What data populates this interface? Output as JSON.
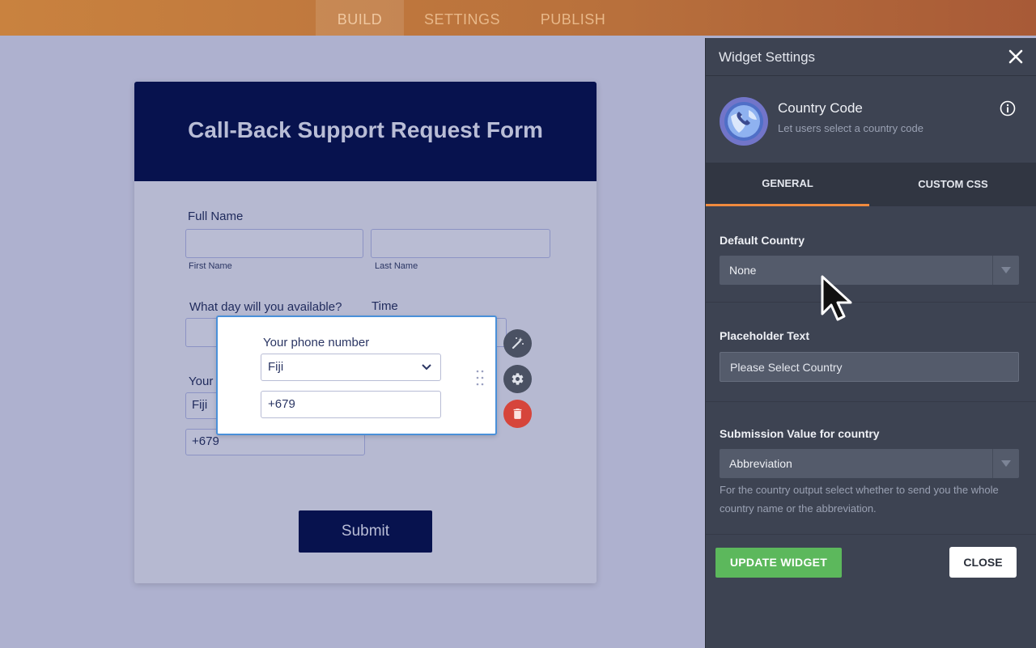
{
  "topbar": {
    "tabs": [
      {
        "label": "BUILD",
        "active": true
      },
      {
        "label": "SETTINGS",
        "active": false
      },
      {
        "label": "PUBLISH",
        "active": false
      }
    ]
  },
  "form": {
    "title": "Call-Back Support Request Form",
    "full_name_label": "Full Name",
    "first_name_sublabel": "First Name",
    "last_name_sublabel": "Last Name",
    "day_label": "What day will you available?",
    "time_label": "Time",
    "phone_label_partial": "Your",
    "phone_country_value": "Fiji",
    "phone_code_value": "+679",
    "submit_label": "Submit"
  },
  "selected_widget": {
    "label": "Your phone number",
    "country_value": "Fiji",
    "code_value": "+679",
    "actions": [
      "magic-wand-icon",
      "gear-icon",
      "trash-icon"
    ]
  },
  "panel": {
    "title": "Widget Settings",
    "widget_name": "Country Code",
    "widget_description": "Let users select a country code",
    "tabs": [
      {
        "label": "GENERAL",
        "active": true
      },
      {
        "label": "CUSTOM CSS",
        "active": false
      }
    ],
    "default_country": {
      "label": "Default Country",
      "value": "None"
    },
    "placeholder_text": {
      "label": "Placeholder Text",
      "value": "Please Select Country"
    },
    "submission_value": {
      "label": "Submission Value for country",
      "value": "Abbreviation",
      "help": "For the country output select whether to send you the whole country name or the abbreviation."
    },
    "update_button": "UPDATE WIDGET",
    "close_button": "CLOSE"
  },
  "colors": {
    "accent_orange": "#f08a3e",
    "update_green": "#5cb85c",
    "form_header_navy": "#07124e",
    "selection_blue": "#4a90d9"
  }
}
